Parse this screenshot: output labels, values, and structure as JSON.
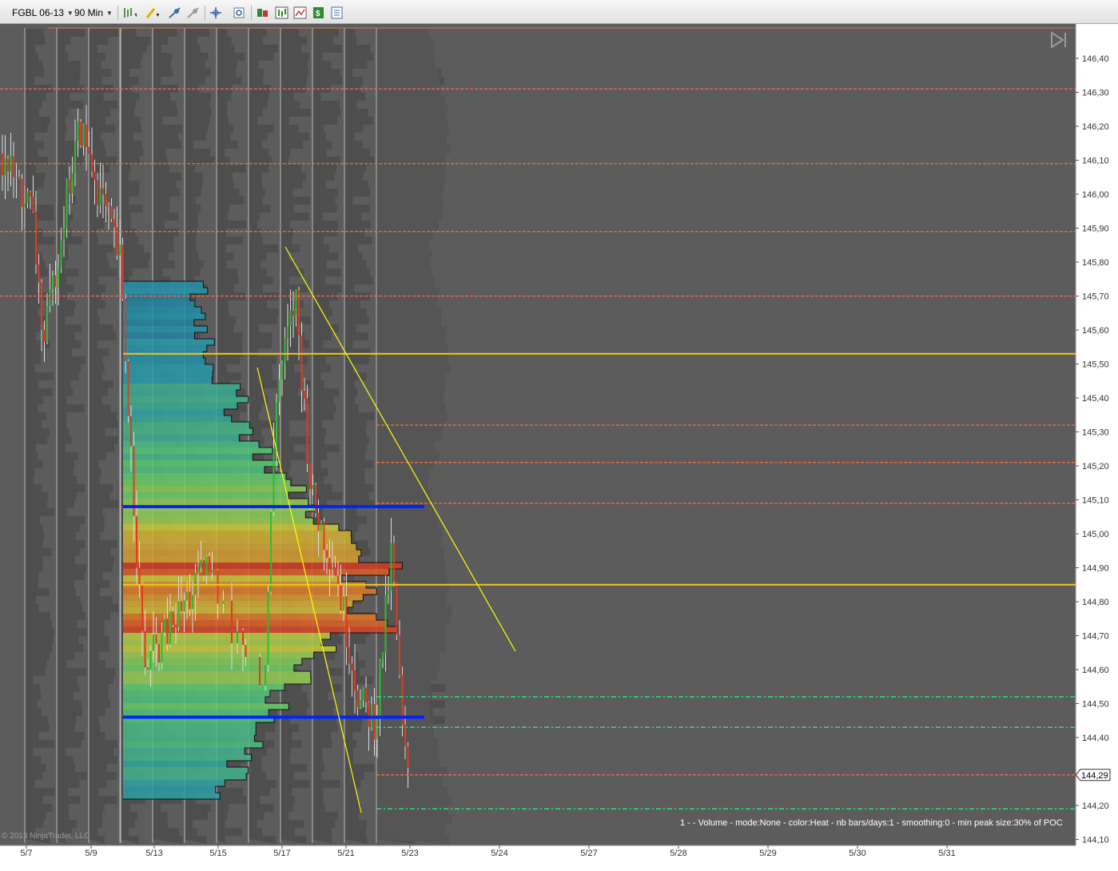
{
  "toolbar": {
    "instrument": "FGBL 06-13",
    "interval": "90 Min",
    "icons": [
      "bar-type-icon",
      "drawing-pencil-icon",
      "snap-on-icon",
      "snap-off-icon",
      "crosshair-icon",
      "zoom-icon",
      "strategies-icon",
      "indicators-icon",
      "chart-style-icon",
      "trade-money-icon",
      "properties-icon"
    ]
  },
  "chart_data": {
    "type": "candlestick",
    "xlabel": "",
    "ylabel": "",
    "y_ticks": [
      "146,40",
      "146,30",
      "146,20",
      "146,10",
      "146,00",
      "145,90",
      "145,80",
      "145,70",
      "145,60",
      "145,50",
      "145,40",
      "145,30",
      "145,20",
      "145,10",
      "145,00",
      "144,90",
      "144,80",
      "144,70",
      "144,60",
      "144,50",
      "144,40",
      "144,20",
      "144,10"
    ],
    "x_ticks": [
      "5/7",
      "5/9",
      "5/13",
      "5/15",
      "5/17",
      "5/21",
      "5/23",
      "5/24",
      "5/27",
      "5/28",
      "5/29",
      "5/30",
      "5/31"
    ],
    "ylim": [
      144.08,
      146.48
    ],
    "last_price": "144,29",
    "study_label": "1 -   - Volume - mode:None - color:Heat - nb bars/days:1 - smoothing:0 - min peak size:30% of POC",
    "horizontal_levels": [
      {
        "price": 146.31,
        "style": "orange-dashed"
      },
      {
        "price": 146.09,
        "style": "orange-dashed"
      },
      {
        "price": 145.89,
        "style": "orange-dashed"
      },
      {
        "price": 145.7,
        "style": "orange-dashed"
      },
      {
        "price": 145.53,
        "style": "yellow-solid"
      },
      {
        "price": 145.32,
        "style": "orange-dashed"
      },
      {
        "price": 145.21,
        "style": "orange-dashed"
      },
      {
        "price": 145.09,
        "style": "orange-dashed"
      },
      {
        "price": 144.85,
        "style": "yellow-solid"
      },
      {
        "price": 144.52,
        "style": "green-dashdot"
      },
      {
        "price": 144.43,
        "style": "green-dashdot"
      },
      {
        "price": 144.29,
        "style": "orange-dashed"
      },
      {
        "price": 144.19,
        "style": "green-dashdot"
      }
    ],
    "value_area": {
      "high": 145.08,
      "low": 144.46
    },
    "copyright": "© 2013 NinjaTrader, LLC",
    "colors": {
      "background": "#5c5c5c",
      "profile": "#4a4a4a",
      "poc_line": "#f5c518",
      "level_line": "#ff6a3d",
      "support": "#27e07a",
      "value_area": "#0026ff",
      "trend": "#ffff00"
    }
  }
}
